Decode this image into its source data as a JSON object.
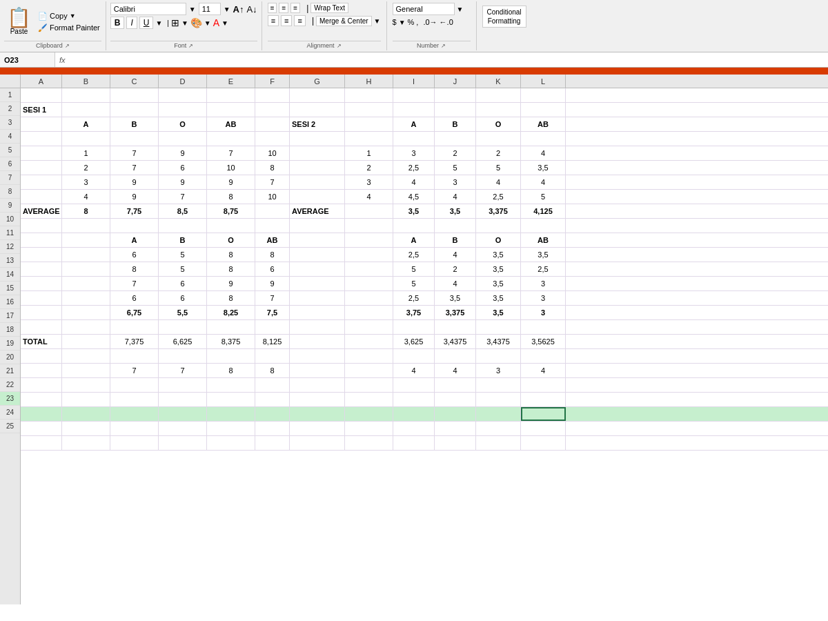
{
  "ribbon": {
    "font_name": "Calibri",
    "font_size": "11",
    "paste_label": "Paste",
    "copy_label": "Copy",
    "format_painter_label": "Format Painter",
    "clipboard_label": "Clipboard",
    "font_label": "Font",
    "alignment_label": "Alignment",
    "number_label": "Number",
    "wrap_text_label": "Wrap Text",
    "merge_center_label": "Merge & Center",
    "general_label": "General",
    "conditional_label": "Conditional\nFormatting"
  },
  "formula_bar": {
    "cell_ref": "O23",
    "fx": "fx"
  },
  "columns": [
    "A",
    "B",
    "C",
    "D",
    "E",
    "F",
    "G",
    "H",
    "I",
    "J",
    "K",
    "L"
  ],
  "rows": [
    {
      "num": "1",
      "cells": [
        "",
        "",
        "",
        "",
        "",
        "",
        "",
        "",
        "",
        "",
        "",
        ""
      ]
    },
    {
      "num": "2",
      "cells": [
        "SESI 1",
        "",
        "",
        "",
        "",
        "",
        "",
        "",
        "",
        "",
        "",
        ""
      ]
    },
    {
      "num": "3",
      "cells": [
        "",
        "A",
        "B",
        "O",
        "AB",
        "",
        "SESI 2",
        "",
        "A",
        "B",
        "O",
        "AB"
      ]
    },
    {
      "num": "4",
      "cells": [
        "",
        "",
        "",
        "",
        "",
        "",
        "",
        "",
        "",
        "",
        "",
        ""
      ]
    },
    {
      "num": "5",
      "cells": [
        "",
        "1",
        "7",
        "9",
        "7",
        "10",
        "",
        "1",
        "3",
        "2",
        "2",
        "4"
      ]
    },
    {
      "num": "6",
      "cells": [
        "",
        "2",
        "7",
        "6",
        "10",
        "8",
        "",
        "2",
        "2,5",
        "5",
        "5",
        "3,5"
      ]
    },
    {
      "num": "7",
      "cells": [
        "",
        "3",
        "9",
        "9",
        "9",
        "7",
        "",
        "3",
        "4",
        "3",
        "4",
        "4"
      ]
    },
    {
      "num": "8",
      "cells": [
        "",
        "4",
        "9",
        "7",
        "8",
        "10",
        "",
        "4",
        "4,5",
        "4",
        "2,5",
        "5"
      ]
    },
    {
      "num": "9",
      "cells": [
        "AVERAGE",
        "",
        "8",
        "7,75",
        "8,5",
        "8,75",
        "",
        "AVERAGE",
        "3,5",
        "3,5",
        "3,375",
        "4,125"
      ]
    },
    {
      "num": "10",
      "cells": [
        "",
        "",
        "",
        "",
        "",
        "",
        "",
        "",
        "",
        "",
        "",
        ""
      ]
    },
    {
      "num": "11",
      "cells": [
        "",
        "",
        "A",
        "B",
        "O",
        "AB",
        "",
        "",
        "A",
        "B",
        "O",
        "AB"
      ]
    },
    {
      "num": "12",
      "cells": [
        "",
        "",
        "6",
        "5",
        "8",
        "8",
        "",
        "",
        "2,5",
        "4",
        "3,5",
        "3,5"
      ]
    },
    {
      "num": "13",
      "cells": [
        "",
        "",
        "8",
        "5",
        "8",
        "6",
        "",
        "",
        "5",
        "2",
        "3,5",
        "2,5"
      ]
    },
    {
      "num": "14",
      "cells": [
        "",
        "",
        "7",
        "6",
        "9",
        "9",
        "",
        "",
        "5",
        "4",
        "3,5",
        "3"
      ]
    },
    {
      "num": "15",
      "cells": [
        "",
        "",
        "6",
        "6",
        "8",
        "7",
        "",
        "",
        "2,5",
        "3,5",
        "3,5",
        "3"
      ]
    },
    {
      "num": "16",
      "cells": [
        "",
        "",
        "6,75",
        "5,5",
        "8,25",
        "7,5",
        "",
        "",
        "3,75",
        "3,375",
        "3,5",
        "3"
      ]
    },
    {
      "num": "17",
      "cells": [
        "",
        "",
        "",
        "",
        "",
        "",
        "",
        "",
        "",
        "",
        "",
        ""
      ]
    },
    {
      "num": "18",
      "cells": [
        "TOTAL",
        "",
        "7,375",
        "6,625",
        "8,375",
        "8,125",
        "",
        "",
        "3,625",
        "3,4375",
        "3,4375",
        "3,5625"
      ]
    },
    {
      "num": "19",
      "cells": [
        "",
        "",
        "",
        "",
        "",
        "",
        "",
        "",
        "",
        "",
        "",
        ""
      ]
    },
    {
      "num": "20",
      "cells": [
        "",
        "",
        "7",
        "7",
        "8",
        "8",
        "",
        "",
        "4",
        "4",
        "3",
        "4"
      ]
    },
    {
      "num": "21",
      "cells": [
        "",
        "",
        "",
        "",
        "",
        "",
        "",
        "",
        "",
        "",
        "",
        ""
      ]
    },
    {
      "num": "22",
      "cells": [
        "",
        "",
        "",
        "",
        "",
        "",
        "",
        "",
        "",
        "",
        "",
        ""
      ]
    },
    {
      "num": "23",
      "cells": [
        "",
        "",
        "",
        "",
        "",
        "",
        "",
        "",
        "",
        "",
        "",
        ""
      ]
    },
    {
      "num": "24",
      "cells": [
        "",
        "",
        "",
        "",
        "",
        "",
        "",
        "",
        "",
        "",
        "",
        ""
      ]
    },
    {
      "num": "25",
      "cells": [
        "",
        "",
        "",
        "",
        "",
        "",
        "",
        "",
        "",
        "",
        "",
        ""
      ]
    }
  ]
}
